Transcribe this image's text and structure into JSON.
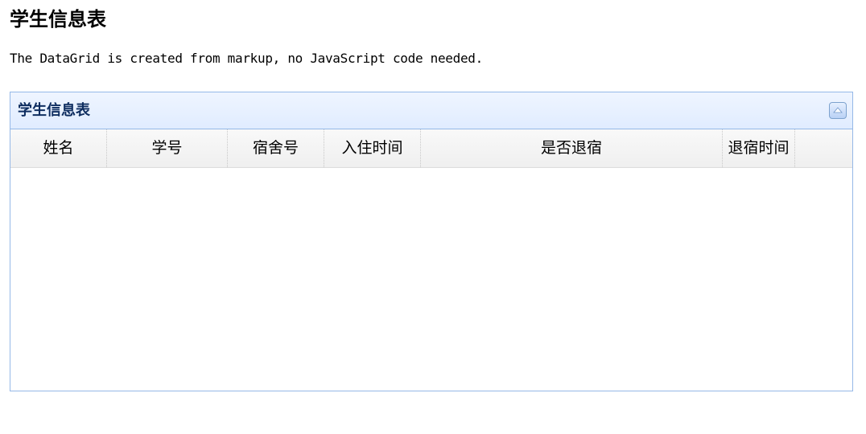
{
  "page": {
    "title": "学生信息表",
    "intro": "The DataGrid is created from markup, no JavaScript code needed."
  },
  "panel": {
    "title": "学生信息表",
    "tool_icon": "collapse-up-icon",
    "border_color": "#95b8e7",
    "header_color": "#e0ecff",
    "title_color": "#0e2d5f"
  },
  "grid": {
    "columns": [
      {
        "label": "姓名"
      },
      {
        "label": "学号"
      },
      {
        "label": "宿舍号"
      },
      {
        "label": "入住时间"
      },
      {
        "label": "是否退宿"
      },
      {
        "label": "退宿时间"
      },
      {
        "label": ""
      }
    ],
    "rows": []
  }
}
